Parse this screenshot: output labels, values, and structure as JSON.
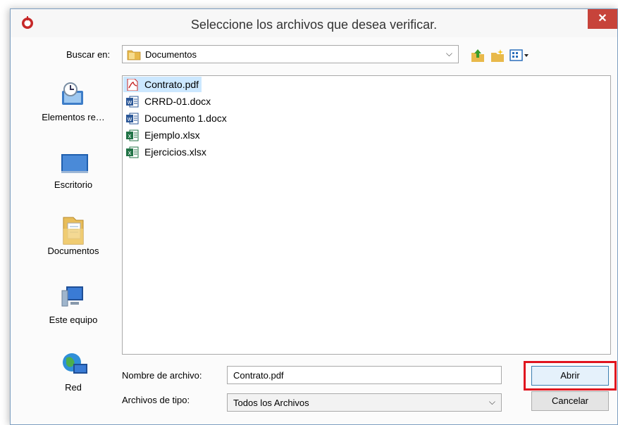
{
  "dialog": {
    "title": "Seleccione los archivos que desea verificar.",
    "close_label": "✕"
  },
  "lookin": {
    "label": "Buscar en:",
    "value": "Documentos"
  },
  "places": [
    {
      "label": "Elementos re…",
      "icon": "recent-items-icon"
    },
    {
      "label": "Escritorio",
      "icon": "desktop-icon"
    },
    {
      "label": "Documentos",
      "icon": "documents-folder-icon"
    },
    {
      "label": "Este equipo",
      "icon": "computer-icon"
    },
    {
      "label": "Red",
      "icon": "network-icon"
    }
  ],
  "files": [
    {
      "name": "Contrato.pdf",
      "type": "pdf",
      "selected": true
    },
    {
      "name": "CRRD-01.docx",
      "type": "word"
    },
    {
      "name": "Documento 1.docx",
      "type": "word"
    },
    {
      "name": "Ejemplo.xlsx",
      "type": "excel"
    },
    {
      "name": "Ejercicios.xlsx",
      "type": "excel"
    }
  ],
  "filename": {
    "label": "Nombre de archivo:",
    "value": "Contrato.pdf"
  },
  "filetype": {
    "label": "Archivos de tipo:",
    "value": "Todos los Archivos"
  },
  "buttons": {
    "open": "Abrir",
    "cancel": "Cancelar"
  },
  "colors": {
    "highlight": "#e0141e",
    "selection": "#cce8ff",
    "close": "#c7433a"
  }
}
